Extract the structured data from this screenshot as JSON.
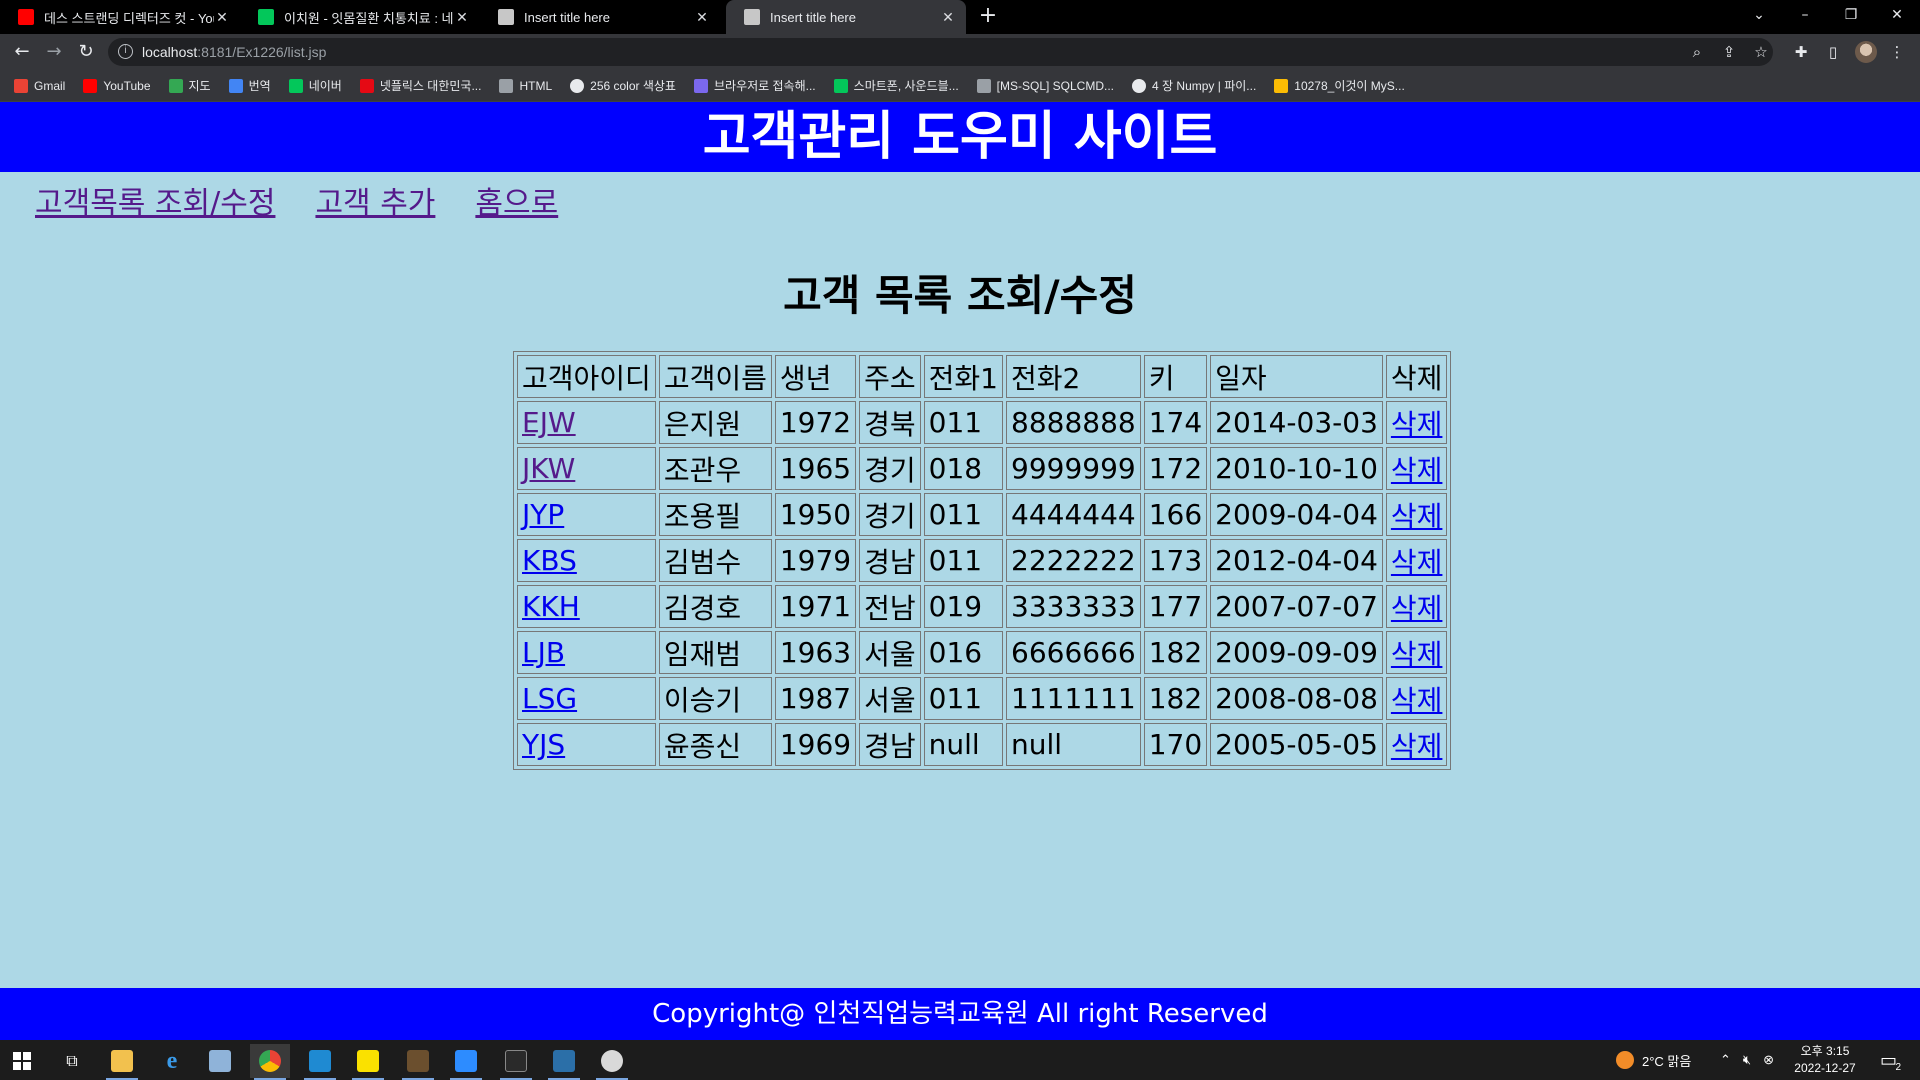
{
  "browser": {
    "tabs": [
      {
        "title": "데스 스트랜딩 디렉터즈 컷 - You",
        "icon": "youtube-icon",
        "color": "#ff0000"
      },
      {
        "title": "이치원 - 잇몸질환 치통치료 : 네",
        "icon": "naver-icon",
        "color": "#03c75a"
      },
      {
        "title": "Insert title here",
        "icon": "page-icon",
        "color": "#c7c7c7"
      },
      {
        "title": "Insert title here",
        "icon": "page-icon",
        "color": "#c7c7c7"
      }
    ],
    "url_host": "localhost",
    "url_rest": ":8181/Ex1226/list.jsp",
    "bookmarks": [
      {
        "label": "Gmail",
        "color": "#ea4335"
      },
      {
        "label": "YouTube",
        "color": "#ff0000"
      },
      {
        "label": "지도",
        "color": "#34a853"
      },
      {
        "label": "번역",
        "color": "#4285f4"
      },
      {
        "label": "네이버",
        "color": "#03c75a"
      },
      {
        "label": "넷플릭스 대한민국...",
        "color": "#e50914"
      },
      {
        "label": "HTML",
        "color": "#9aa0a6"
      },
      {
        "label": "256 color 색상표",
        "color": "#e8eaed"
      },
      {
        "label": "브라우저로 접속해...",
        "color": "#7b68ee"
      },
      {
        "label": "스마트폰, 사운드블...",
        "color": "#03c75a"
      },
      {
        "label": "[MS-SQL] SQLCMD...",
        "color": "#9aa0a6"
      },
      {
        "label": "4 장 Numpy | 파이...",
        "color": "#e8eaed"
      },
      {
        "label": "10278_이것이 MyS...",
        "color": "#fbbc04"
      }
    ]
  },
  "site": {
    "title": "고객관리 도우미 사이트",
    "menu": {
      "list": "고객목록 조회/수정",
      "add": "고객 추가",
      "home": "홈으로"
    },
    "page_title": "고객 목록 조회/수정",
    "table": {
      "headers": [
        "고객아이디",
        "고객이름",
        "생년",
        "주소",
        "전화1",
        "전화2",
        "키",
        "일자",
        "삭제"
      ],
      "rows": [
        {
          "id": "EJW",
          "name": "은지원",
          "birth": "1972",
          "addr": "경북",
          "tel1": "011",
          "tel2": "8888888",
          "height": "174",
          "date": "2014-03-03",
          "del": "삭제"
        },
        {
          "id": "JKW",
          "name": "조관우",
          "birth": "1965",
          "addr": "경기",
          "tel1": "018",
          "tel2": "9999999",
          "height": "172",
          "date": "2010-10-10",
          "del": "삭제"
        },
        {
          "id": "JYP",
          "name": "조용필",
          "birth": "1950",
          "addr": "경기",
          "tel1": "011",
          "tel2": "4444444",
          "height": "166",
          "date": "2009-04-04",
          "del": "삭제"
        },
        {
          "id": "KBS",
          "name": "김범수",
          "birth": "1979",
          "addr": "경남",
          "tel1": "011",
          "tel2": "2222222",
          "height": "173",
          "date": "2012-04-04",
          "del": "삭제"
        },
        {
          "id": "KKH",
          "name": "김경호",
          "birth": "1971",
          "addr": "전남",
          "tel1": "019",
          "tel2": "3333333",
          "height": "177",
          "date": "2007-07-07",
          "del": "삭제"
        },
        {
          "id": "LJB",
          "name": "임재범",
          "birth": "1963",
          "addr": "서울",
          "tel1": "016",
          "tel2": "6666666",
          "height": "182",
          "date": "2009-09-09",
          "del": "삭제"
        },
        {
          "id": "LSG",
          "name": "이승기",
          "birth": "1987",
          "addr": "서울",
          "tel1": "011",
          "tel2": "1111111",
          "height": "182",
          "date": "2008-08-08",
          "del": "삭제"
        },
        {
          "id": "YJS",
          "name": "윤종신",
          "birth": "1969",
          "addr": "경남",
          "tel1": "null",
          "tel2": "null",
          "height": "170",
          "date": "2005-05-05",
          "del": "삭제"
        }
      ]
    },
    "footer": "Copyright@ 인천직업능력교육원 All right Reserved"
  },
  "taskbar": {
    "weather": "2°C  맑음",
    "time": "오후 3:15",
    "date": "2022-12-27",
    "notifications": "2"
  }
}
